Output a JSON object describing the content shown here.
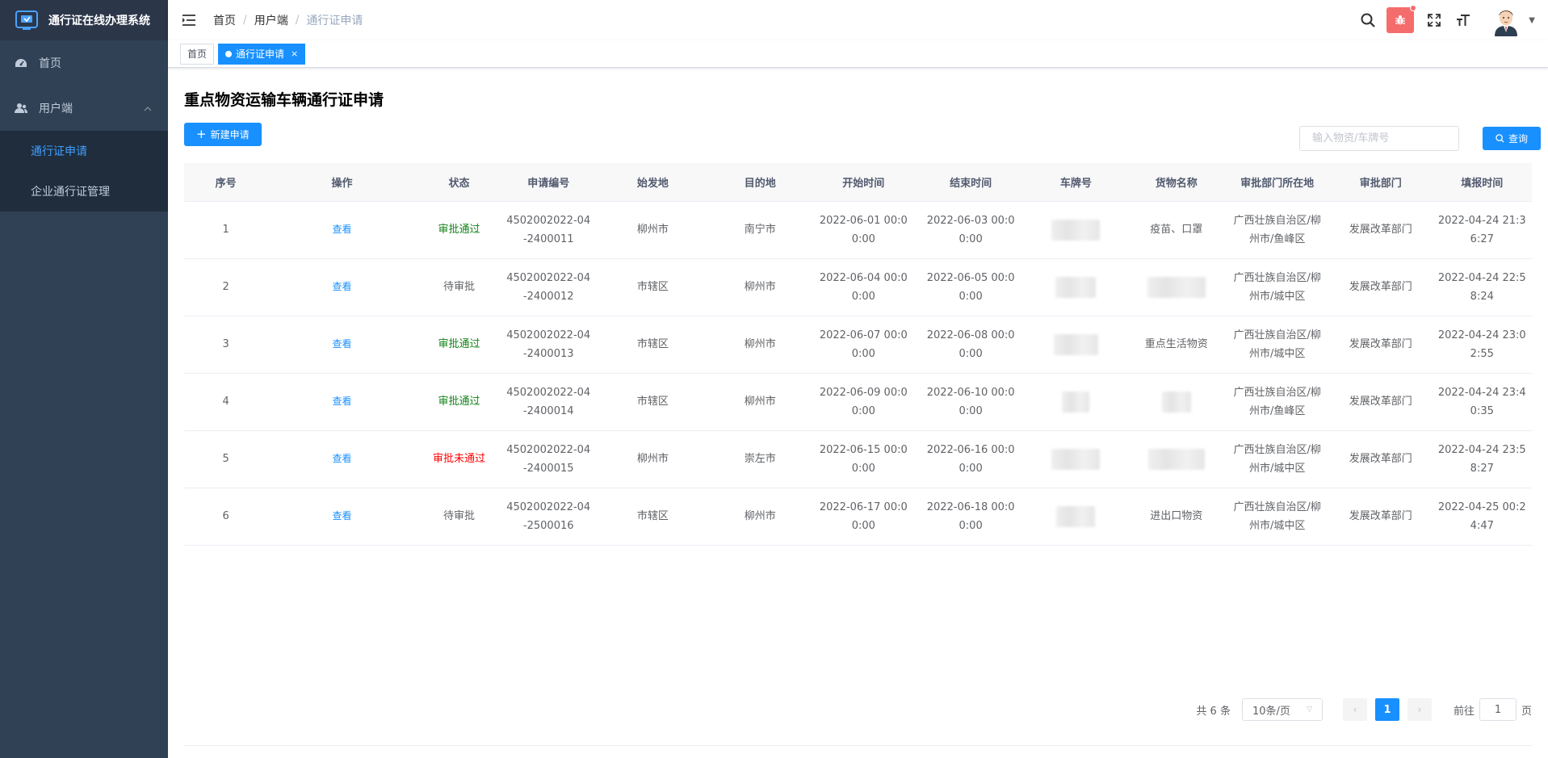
{
  "app": {
    "title": "通行证在线办理系统"
  },
  "sidebar": {
    "items": [
      {
        "label": "首页",
        "icon": "dashboard-icon"
      },
      {
        "label": "用户端",
        "icon": "user-icon",
        "expanded": true,
        "children": [
          {
            "label": "通行证申请",
            "active": true
          },
          {
            "label": "企业通行证管理",
            "active": false
          }
        ]
      }
    ]
  },
  "navbar": {
    "breadcrumb": [
      "首页",
      "用户端",
      "通行证申请"
    ],
    "icons": [
      "search-icon",
      "bug-icon",
      "fullscreen-icon",
      "font-size-icon"
    ]
  },
  "tags": [
    {
      "label": "首页",
      "active": false
    },
    {
      "label": "通行证申请",
      "active": true
    }
  ],
  "page": {
    "title": "重点物资运输车辆通行证申请",
    "new_button": "新建申请",
    "search_placeholder": "输入物资/车牌号",
    "query_button": "查询"
  },
  "table": {
    "columns": [
      "序号",
      "操作",
      "状态",
      "申请编号",
      "始发地",
      "目的地",
      "开始时间",
      "结束时间",
      "车牌号",
      "货物名称",
      "审批部门所在地",
      "审批部门",
      "填报时间"
    ],
    "rows": [
      {
        "no": "1",
        "op": "查看",
        "status": "审批通过",
        "status_type": "pass",
        "code": "4502002022-04-2400011",
        "from": "柳州市",
        "to": "南宁市",
        "start": "2022-06-01 00:00:00",
        "end": "2022-06-03 00:00:00",
        "plate": "",
        "goods": "疫苗、口罩",
        "dept_loc": "广西壮族自治区/柳州市/鱼峰区",
        "dept": "发展改革部门",
        "filed": "2022-04-24 21:36:27"
      },
      {
        "no": "2",
        "op": "查看",
        "status": "待审批",
        "status_type": "wait",
        "code": "4502002022-04-2400012",
        "from": "市辖区",
        "to": "柳州市",
        "start": "2022-06-04 00:00:00",
        "end": "2022-06-05 00:00:00",
        "plate": "",
        "goods": "",
        "dept_loc": "广西壮族自治区/柳州市/城中区",
        "dept": "发展改革部门",
        "filed": "2022-04-24 22:58:24"
      },
      {
        "no": "3",
        "op": "查看",
        "status": "审批通过",
        "status_type": "pass",
        "code": "4502002022-04-2400013",
        "from": "市辖区",
        "to": "柳州市",
        "start": "2022-06-07 00:00:00",
        "end": "2022-06-08 00:00:00",
        "plate": "",
        "goods": "重点生活物资",
        "dept_loc": "广西壮族自治区/柳州市/城中区",
        "dept": "发展改革部门",
        "filed": "2022-04-24 23:02:55"
      },
      {
        "no": "4",
        "op": "查看",
        "status": "审批通过",
        "status_type": "pass",
        "code": "4502002022-04-2400014",
        "from": "市辖区",
        "to": "柳州市",
        "start": "2022-06-09 00:00:00",
        "end": "2022-06-10 00:00:00",
        "plate": "",
        "goods": "",
        "dept_loc": "广西壮族自治区/柳州市/鱼峰区",
        "dept": "发展改革部门",
        "filed": "2022-04-24 23:40:35"
      },
      {
        "no": "5",
        "op": "查看",
        "status": "审批未通过",
        "status_type": "fail",
        "code": "4502002022-04-2400015",
        "from": "柳州市",
        "to": "崇左市",
        "start": "2022-06-15 00:00:00",
        "end": "2022-06-16 00:00:00",
        "plate": "",
        "goods": "",
        "dept_loc": "广西壮族自治区/柳州市/城中区",
        "dept": "发展改革部门",
        "filed": "2022-04-24 23:58:27"
      },
      {
        "no": "6",
        "op": "查看",
        "status": "待审批",
        "status_type": "wait",
        "code": "4502002022-04-2500016",
        "from": "市辖区",
        "to": "柳州市",
        "start": "2022-06-17 00:00:00",
        "end": "2022-06-18 00:00:00",
        "plate": "",
        "goods": "进出口物资",
        "dept_loc": "广西壮族自治区/柳州市/城中区",
        "dept": "发展改革部门",
        "filed": "2022-04-25 00:24:47"
      }
    ]
  },
  "pagination": {
    "total_text": "共 6 条",
    "page_size": "10条/页",
    "current_page": "1",
    "goto_prefix": "前往",
    "goto_value": "1",
    "goto_suffix": "页"
  },
  "colors": {
    "primary": "#1890ff",
    "sidebar_bg": "#304156",
    "pass": "#13821a",
    "fail": "#ff0000"
  }
}
